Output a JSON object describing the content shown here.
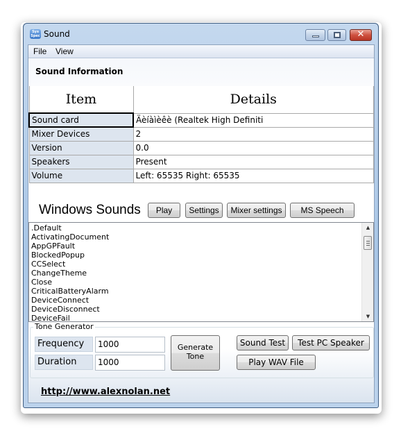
{
  "window": {
    "title": "Sound",
    "app_icon_text": "Sys Spec",
    "controls": {
      "minimize": "minimize",
      "maximize": "maximize",
      "close": "✕"
    }
  },
  "menu": [
    "File",
    "View"
  ],
  "section_title": "Sound Information",
  "table": {
    "headers": [
      "Item",
      "Details"
    ],
    "rows": [
      {
        "key": "Sound card",
        "value": "Äèíàìèêè (Realtek High Definiti"
      },
      {
        "key": "Mixer Devices",
        "value": "2"
      },
      {
        "key": "Version",
        "value": "0.0"
      },
      {
        "key": "Speakers",
        "value": "Present"
      },
      {
        "key": "Volume",
        "value": "Left: 65535 Right: 65535"
      }
    ]
  },
  "windows_sounds": {
    "title": "Windows Sounds",
    "buttons": [
      "Play",
      "Settings",
      "Mixer settings",
      "MS Speech"
    ],
    "items": [
      ".Default",
      "ActivatingDocument",
      "AppGPFault",
      "BlockedPopup",
      "CCSelect",
      "ChangeTheme",
      "Close",
      "CriticalBatteryAlarm",
      "DeviceConnect",
      "DeviceDisconnect",
      "DeviceFail"
    ]
  },
  "tone_generator": {
    "label": "Tone Generator",
    "frequency_label": "Frequency",
    "frequency_value": "1000",
    "duration_label": "Duration",
    "duration_value": "1000",
    "generate_label": "Generate Tone",
    "sound_test_label": "Sound Test",
    "pc_speaker_label": "Test PC Speaker",
    "play_wav_label": "Play WAV File"
  },
  "footer_link": "http://www.alexnolan.net",
  "colors": {
    "key_cell_bg": "#dde5ef",
    "close_button": "#cf5140",
    "title_bar": "#b9d1ea"
  }
}
